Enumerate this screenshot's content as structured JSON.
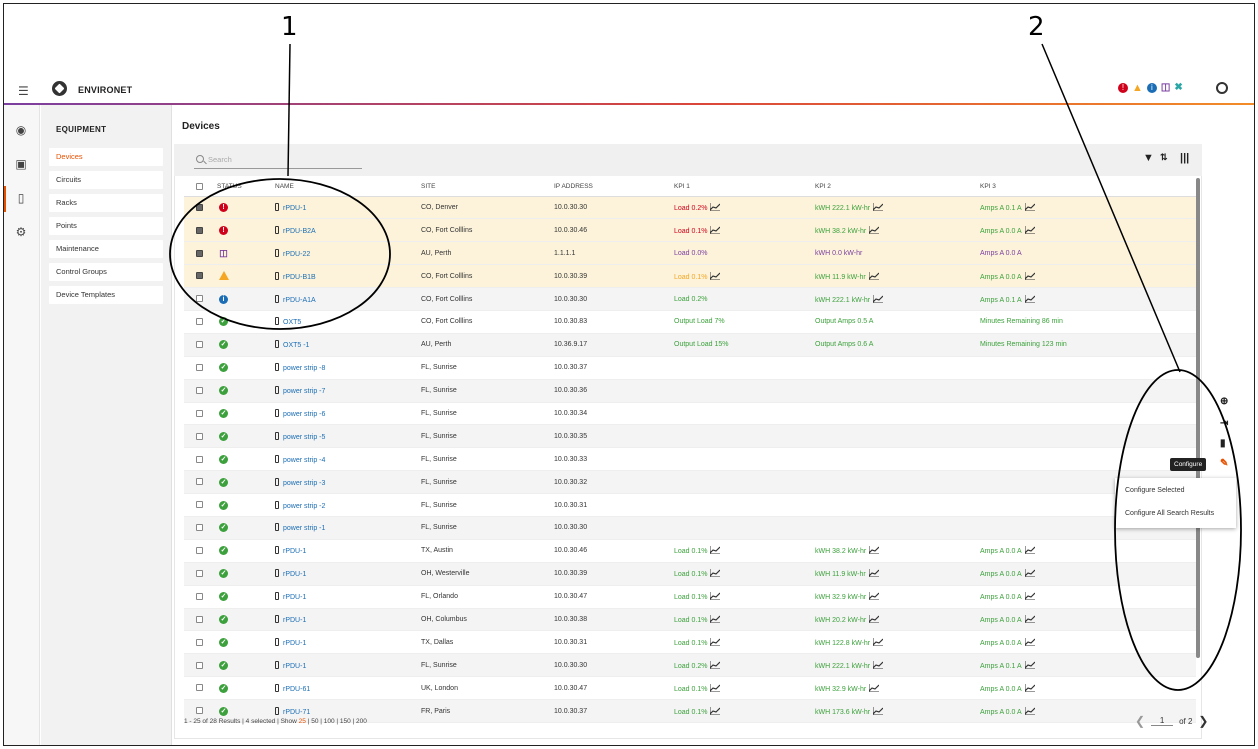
{
  "callouts": [
    "1",
    "2"
  ],
  "app": {
    "name": "ENVIRONET"
  },
  "colors": {
    "accent": "#e65100",
    "link": "#1b6eb5",
    "critical": "#d0021b",
    "ok": "#3ca13c",
    "warning": "#f5a623",
    "comm": "#7b3fa0"
  },
  "nav": {
    "title": "EQUIPMENT",
    "items": [
      {
        "label": "Devices",
        "active": true
      },
      {
        "label": "Circuits"
      },
      {
        "label": "Racks"
      },
      {
        "label": "Points"
      },
      {
        "label": "Maintenance"
      },
      {
        "label": "Control Groups"
      },
      {
        "label": "Device Templates"
      }
    ]
  },
  "page": {
    "title": "Devices"
  },
  "search": {
    "placeholder": "Search"
  },
  "table": {
    "columns": [
      "STATUS",
      "NAME",
      "SITE",
      "IP ADDRESS",
      "KPI 1",
      "KPI 2",
      "KPI 3"
    ],
    "rows": [
      {
        "checked": true,
        "status": "critical",
        "name": "rPDU-1",
        "site": "CO, Denver",
        "ip": "10.0.30.30",
        "kpi1": "Load 0.2%",
        "kpi1_color": "red",
        "kpi1_trend": true,
        "kpi2": "kWH 222.1 kW-hr",
        "kpi2_color": "green",
        "kpi2_trend": true,
        "kpi3": "Amps A 0.1 A",
        "kpi3_trend": true
      },
      {
        "checked": true,
        "status": "critical",
        "name": "rPDU-B2A",
        "site": "CO, Fort Colllins",
        "ip": "10.0.30.46",
        "kpi1": "Load 0.1%",
        "kpi1_color": "red",
        "kpi1_trend": true,
        "kpi2": "kWH 38.2 kW-hr",
        "kpi2_color": "green",
        "kpi2_trend": true,
        "kpi3": "Amps A 0.0 A",
        "kpi3_trend": true
      },
      {
        "checked": true,
        "status": "comm",
        "name": "rPDU-22",
        "site": "AU, Perth",
        "ip": "1.1.1.1",
        "kpi1": "Load 0.0%",
        "kpi1_color": "purple",
        "kpi2": "kWH 0.0 kW-hr",
        "kpi2_color": "purple",
        "kpi3": "Amps A 0.0 A",
        "kpi3_color": "purple"
      },
      {
        "checked": true,
        "status": "warning",
        "name": "rPDU-B1B",
        "site": "CO, Fort Colllins",
        "ip": "10.0.30.39",
        "kpi1": "Load 0.1%",
        "kpi1_color": "amber",
        "kpi1_trend": true,
        "kpi2": "kWH 11.9 kW-hr",
        "kpi2_color": "green",
        "kpi2_trend": true,
        "kpi3": "Amps A 0.0 A",
        "kpi3_trend": true
      },
      {
        "checked": false,
        "status": "info",
        "name": "rPDU-A1A",
        "site": "CO, Fort Colllins",
        "ip": "10.0.30.30",
        "kpi1": "Load 0.2%",
        "kpi1_color": "green",
        "kpi2": "kWH 222.1 kW-hr",
        "kpi2_color": "green",
        "kpi2_trend": true,
        "kpi3": "Amps A 0.1 A",
        "kpi3_trend": true
      },
      {
        "checked": false,
        "status": "ok",
        "name": "OXT5",
        "site": "CO, Fort Colllins",
        "ip": "10.0.30.83",
        "kpi1": "Output Load 7%",
        "kpi1_color": "green",
        "kpi2": "Output Amps 0.5 A",
        "kpi2_color": "green",
        "kpi3": "Minutes Remaining 86 min"
      },
      {
        "checked": false,
        "status": "ok",
        "name": "OXT5 -1",
        "site": "AU, Perth",
        "ip": "10.36.9.17",
        "kpi1": "Output Load 15%",
        "kpi1_color": "green",
        "kpi2": "Output Amps 0.6 A",
        "kpi2_color": "green",
        "kpi3": "Minutes Remaining 123 min"
      },
      {
        "checked": false,
        "status": "ok",
        "name": "power strip -8",
        "site": "FL, Sunrise",
        "ip": "10.0.30.37"
      },
      {
        "checked": false,
        "status": "ok",
        "name": "power strip -7",
        "site": "FL, Sunrise",
        "ip": "10.0.30.36"
      },
      {
        "checked": false,
        "status": "ok",
        "name": "power strip -6",
        "site": "FL, Sunrise",
        "ip": "10.0.30.34"
      },
      {
        "checked": false,
        "status": "ok",
        "name": "power strip -5",
        "site": "FL, Sunrise",
        "ip": "10.0.30.35"
      },
      {
        "checked": false,
        "status": "ok",
        "name": "power strip -4",
        "site": "FL, Sunrise",
        "ip": "10.0.30.33"
      },
      {
        "checked": false,
        "status": "ok",
        "name": "power strip -3",
        "site": "FL, Sunrise",
        "ip": "10.0.30.32"
      },
      {
        "checked": false,
        "status": "ok",
        "name": "power strip -2",
        "site": "FL, Sunrise",
        "ip": "10.0.30.31"
      },
      {
        "checked": false,
        "status": "ok",
        "name": "power strip -1",
        "site": "FL, Sunrise",
        "ip": "10.0.30.30"
      },
      {
        "checked": false,
        "status": "ok",
        "name": "rPDU-1",
        "site": "TX, Austin",
        "ip": "10.0.30.46",
        "kpi1": "Load 0.1%",
        "kpi1_color": "green",
        "kpi1_trend": true,
        "kpi2": "kWH 38.2 kW-hr",
        "kpi2_color": "green",
        "kpi2_trend": true,
        "kpi3": "Amps A 0.0 A",
        "kpi3_trend": true
      },
      {
        "checked": false,
        "status": "ok",
        "name": "rPDU-1",
        "site": "OH, Westerville",
        "ip": "10.0.30.39",
        "kpi1": "Load 0.1%",
        "kpi1_color": "green",
        "kpi1_trend": true,
        "kpi2": "kWH 11.9 kW-hr",
        "kpi2_color": "green",
        "kpi2_trend": true,
        "kpi3": "Amps A 0.0 A",
        "kpi3_trend": true
      },
      {
        "checked": false,
        "status": "ok",
        "name": "rPDU-1",
        "site": "FL, Orlando",
        "ip": "10.0.30.47",
        "kpi1": "Load 0.1%",
        "kpi1_color": "green",
        "kpi1_trend": true,
        "kpi2": "kWH 32.9 kW-hr",
        "kpi2_color": "green",
        "kpi2_trend": true,
        "kpi3": "Amps A 0.0 A",
        "kpi3_trend": true
      },
      {
        "checked": false,
        "status": "ok",
        "name": "rPDU-1",
        "site": "OH, Columbus",
        "ip": "10.0.30.38",
        "kpi1": "Load 0.1%",
        "kpi1_color": "green",
        "kpi1_trend": true,
        "kpi2": "kWH 20.2 kW-hr",
        "kpi2_color": "green",
        "kpi2_trend": true,
        "kpi3": "Amps A 0.0 A",
        "kpi3_trend": true
      },
      {
        "checked": false,
        "status": "ok",
        "name": "rPDU-1",
        "site": "TX, Dallas",
        "ip": "10.0.30.31",
        "kpi1": "Load 0.1%",
        "kpi1_color": "green",
        "kpi1_trend": true,
        "kpi2": "kWH 122.8 kW-hr",
        "kpi2_color": "green",
        "kpi2_trend": true,
        "kpi3": "Amps A 0.0 A",
        "kpi3_trend": true
      },
      {
        "checked": false,
        "status": "ok",
        "name": "rPDU-1",
        "site": "FL, Sunrise",
        "ip": "10.0.30.30",
        "kpi1": "Load 0.2%",
        "kpi1_color": "green",
        "kpi1_trend": true,
        "kpi2": "kWH 222.1 kW-hr",
        "kpi2_color": "green",
        "kpi2_trend": true,
        "kpi3": "Amps A 0.1 A",
        "kpi3_trend": true
      },
      {
        "checked": false,
        "status": "ok",
        "name": "rPDU-61",
        "site": "UK, London",
        "ip": "10.0.30.47",
        "kpi1": "Load 0.1%",
        "kpi1_color": "green",
        "kpi1_trend": true,
        "kpi2": "kWH 32.9 kW-hr",
        "kpi2_color": "green",
        "kpi2_trend": true,
        "kpi3": "Amps A 0.0 A",
        "kpi3_trend": true
      },
      {
        "checked": false,
        "status": "ok",
        "name": "rPDU-71",
        "site": "FR, Paris",
        "ip": "10.0.30.37",
        "kpi1": "Load 0.1%",
        "kpi1_color": "green",
        "kpi1_trend": true,
        "kpi2": "kWH 173.6 kW-hr",
        "kpi2_color": "green",
        "kpi2_trend": true,
        "kpi3": "Amps A 0.0 A",
        "kpi3_trend": true
      }
    ]
  },
  "footer": {
    "summary": "1 - 25 of 28 Results | 4 selected | Show ",
    "show_current": "25",
    "show_rest": " | 50 | 100 | 150 | 200"
  },
  "pager": {
    "page": "1",
    "of": "of 2"
  },
  "actions": {
    "tooltip": "Configure",
    "menu": [
      "Configure Selected",
      "Configure All Search Results"
    ]
  }
}
